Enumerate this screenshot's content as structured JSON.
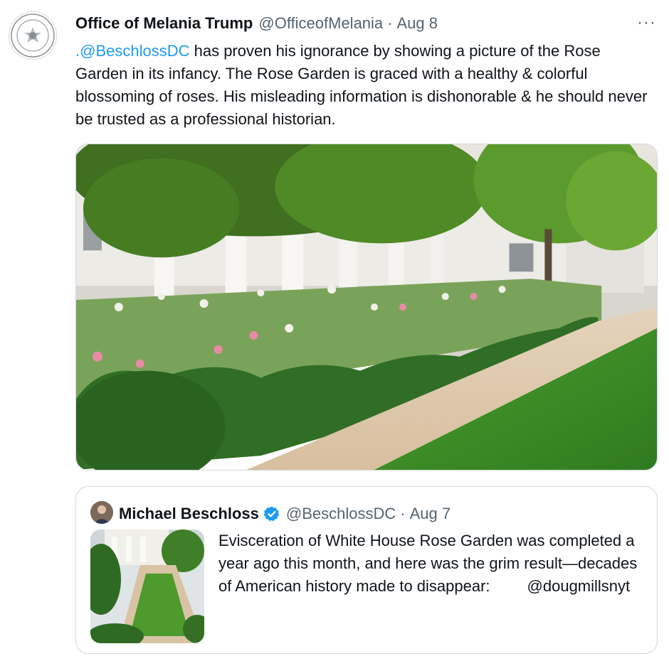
{
  "tweet": {
    "author_name": "Office of Melania Trump",
    "author_handle": "@OfficeofMelania",
    "separator": "·",
    "date": "Aug 8",
    "more_label": "···",
    "mention": ".@BeschlossDC",
    "body": " has proven his ignorance by showing a picture of the Rose Garden in its infancy. The Rose Garden is graced with a healthy & colorful blossoming of roses. His misleading information is dishonorable & he should never be trusted as a professional historian."
  },
  "quoted_tweet": {
    "author_name": "Michael Beschloss",
    "author_handle": "@BeschlossDC",
    "separator": "·",
    "date": "Aug 7",
    "verified": true,
    "body": "Evisceration of White House Rose Garden was completed a year ago this month, and here was the grim result—decades of American history made to disappear:",
    "credit": "@dougmillsnyt"
  },
  "colors": {
    "link": "#1d9bf0",
    "secondary_text": "#536471",
    "border": "#cfd9de",
    "lawn": "#3f8f2b",
    "hedge": "#2f6e24"
  }
}
